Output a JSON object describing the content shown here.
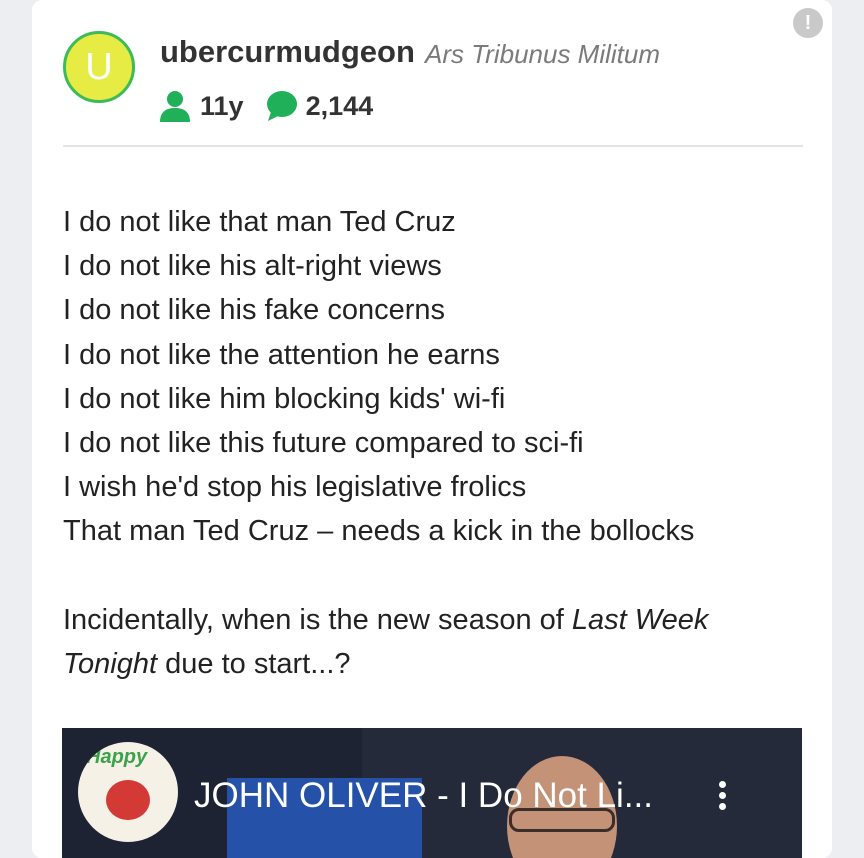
{
  "post": {
    "author": {
      "avatar_letter": "U",
      "username": "ubercurmudgeon",
      "rank": "Ars Tribunus Militum",
      "membership_age": "11y",
      "post_count": "2,144"
    },
    "report_icon_label": "!",
    "body_lines": [
      "I do not like that man Ted Cruz",
      "I do not like his alt-right views",
      "I do not like his fake concerns",
      "I do not like the attention he earns",
      "I do not like him blocking kids' wi-fi",
      "I do not like this future compared to sci-fi",
      "I wish he'd stop his legislative frolics",
      "That man Ted Cruz – needs a kick in the bollocks"
    ],
    "closing_prefix": "Incidentally, when is the new season of ",
    "closing_italic_1": "Last Week",
    "closing_italic_2": "Tonight",
    "closing_suffix": " due to start...?",
    "video": {
      "title": "JOHN OLIVER - I Do Not Li...",
      "channel_avatar_text": "Happy"
    }
  },
  "colors": {
    "avatar_fill": "#e6ec44",
    "avatar_border": "#3cbb58",
    "stat_icon": "#21b05a"
  }
}
